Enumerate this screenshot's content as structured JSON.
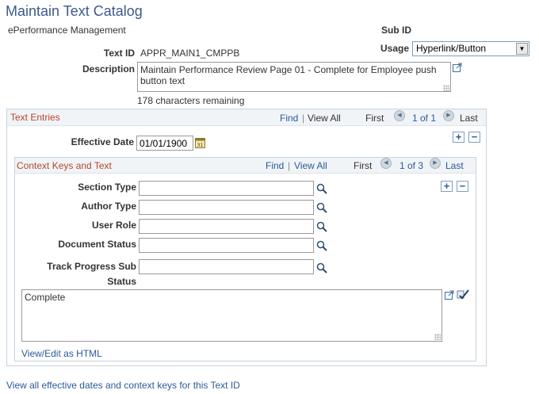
{
  "page": {
    "title": "Maintain Text Catalog",
    "subtitle": "ePerformance Management"
  },
  "header": {
    "sub_id_label": "Sub ID",
    "usage_label": "Usage",
    "usage_value": "Hyperlink/Button",
    "text_id_label": "Text ID",
    "text_id_value": "APPR_MAIN1_CMPPB",
    "description_label": "Description",
    "description_value": "Maintain Performance Review Page 01 - Complete for Employee push button text",
    "chars_remaining": "178 characters remaining"
  },
  "text_entries": {
    "title": "Text Entries",
    "find": "Find",
    "view_all": "View All",
    "first": "First",
    "count": "1 of 1",
    "last": "Last",
    "effective_date_label": "Effective Date",
    "effective_date_value": "01/01/1900",
    "add": "+",
    "remove": "−"
  },
  "context_keys": {
    "title": "Context Keys and Text",
    "find": "Find",
    "view_all": "View All",
    "first": "First",
    "count": "1 of 3",
    "last": "Last",
    "add": "+",
    "remove": "−",
    "fields": {
      "section_type": "Section Type",
      "author_type": "Author Type",
      "user_role": "User Role",
      "document_status": "Document Status",
      "track_progress_line1": "Track Progress Sub",
      "track_progress_line2": "Status"
    },
    "text_value": "Complete",
    "view_edit_html": "View/Edit as HTML"
  },
  "footer": {
    "view_all_link": "View all effective dates and context keys for this Text ID"
  },
  "colors": {
    "title": "#3c5a8c",
    "link": "#2a5a99",
    "group_title": "#b5482b",
    "group_border": "#c7d2dd"
  }
}
